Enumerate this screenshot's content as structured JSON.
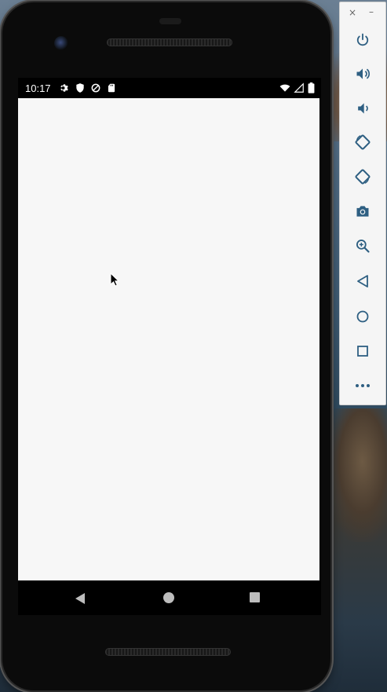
{
  "statusbar": {
    "time": "10:17",
    "left_icons": [
      "settings-icon",
      "shield-icon",
      "data-saver-icon",
      "sd-card-icon"
    ],
    "right_icons": [
      "wifi-icon",
      "cell-signal-icon",
      "battery-icon"
    ]
  },
  "app": {
    "background": "#f7f7f7"
  },
  "navbar": {
    "buttons": [
      "back",
      "home",
      "recents"
    ]
  },
  "toolbar": {
    "close_label": "×",
    "minimize_label": "–",
    "buttons": [
      "power",
      "volume-up",
      "volume-down",
      "rotate-left",
      "rotate-right",
      "screenshot",
      "zoom",
      "back",
      "home",
      "overview",
      "more"
    ]
  },
  "colors": {
    "accent_icon": "#2e5f82",
    "phone_body": "#0b0b0b"
  }
}
